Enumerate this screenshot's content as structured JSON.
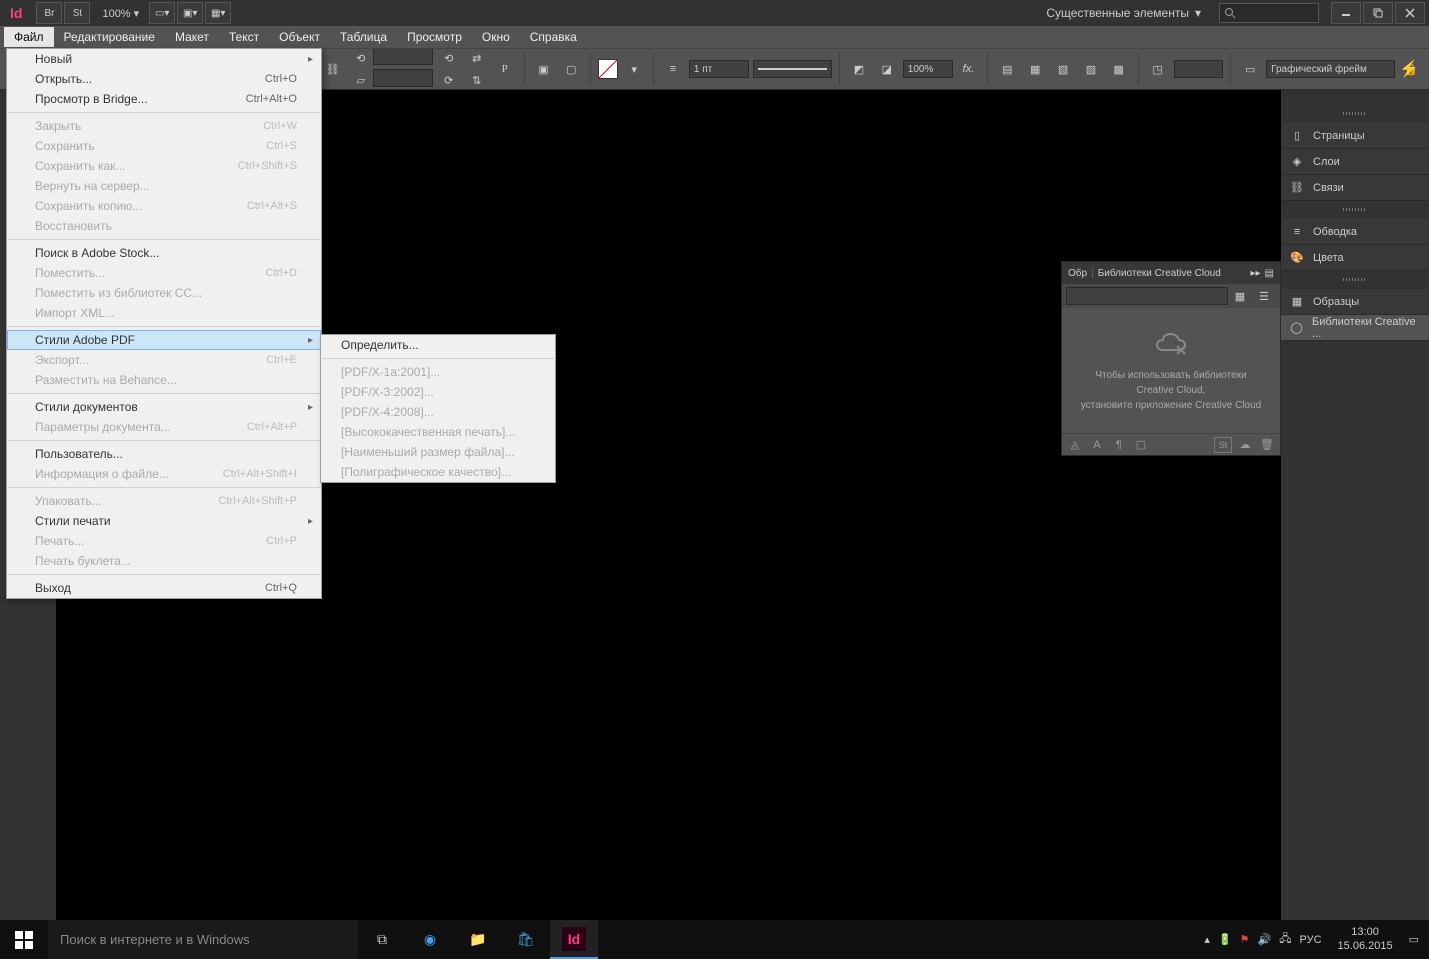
{
  "titlebar": {
    "zoom": "100%",
    "workspace_label": "Существенные элементы",
    "br_label": "Br",
    "st_label": "St"
  },
  "menubar": {
    "items": [
      "Файл",
      "Редактирование",
      "Макет",
      "Текст",
      "Объект",
      "Таблица",
      "Просмотр",
      "Окно",
      "Справка"
    ]
  },
  "ctrlstrip": {
    "stroke_pt": "1 пт",
    "scale_pct": "100%",
    "frame_type": "Графический фрейм"
  },
  "file_menu": {
    "items": [
      {
        "label": "Новый",
        "sub": true
      },
      {
        "label": "Открыть...",
        "shortcut": "Ctrl+O"
      },
      {
        "label": "Просмотр в Bridge...",
        "shortcut": "Ctrl+Alt+O"
      },
      {
        "sep": true
      },
      {
        "label": "Закрыть",
        "shortcut": "Ctrl+W",
        "disabled": true
      },
      {
        "label": "Сохранить",
        "shortcut": "Ctrl+S",
        "disabled": true
      },
      {
        "label": "Сохранить как...",
        "shortcut": "Ctrl+Shift+S",
        "disabled": true
      },
      {
        "label": "Вернуть на сервер...",
        "disabled": true
      },
      {
        "label": "Сохранить копию...",
        "shortcut": "Ctrl+Alt+S",
        "disabled": true
      },
      {
        "label": "Восстановить",
        "disabled": true
      },
      {
        "sep": true
      },
      {
        "label": "Поиск в Adobe Stock..."
      },
      {
        "label": "Поместить...",
        "shortcut": "Ctrl+D",
        "disabled": true
      },
      {
        "label": "Поместить из библиотек CC...",
        "disabled": true
      },
      {
        "label": "Импорт XML...",
        "disabled": true
      },
      {
        "sep": true
      },
      {
        "label": "Стили Adobe PDF",
        "sub": true,
        "hover": true
      },
      {
        "label": "Экспорт...",
        "shortcut": "Ctrl+E",
        "disabled": true
      },
      {
        "label": "Разместить на Behance...",
        "disabled": true
      },
      {
        "sep": true
      },
      {
        "label": "Стили документов",
        "sub": true
      },
      {
        "label": "Параметры документа...",
        "shortcut": "Ctrl+Alt+P",
        "disabled": true
      },
      {
        "sep": true
      },
      {
        "label": "Пользователь..."
      },
      {
        "label": "Информация о файле...",
        "shortcut": "Ctrl+Alt+Shift+I",
        "disabled": true
      },
      {
        "sep": true
      },
      {
        "label": "Упаковать...",
        "shortcut": "Ctrl+Alt+Shift+P",
        "disabled": true
      },
      {
        "label": "Стили печати",
        "sub": true
      },
      {
        "label": "Печать...",
        "shortcut": "Ctrl+P",
        "disabled": true
      },
      {
        "label": "Печать буклета...",
        "disabled": true
      },
      {
        "sep": true
      },
      {
        "label": "Выход",
        "shortcut": "Ctrl+Q"
      }
    ]
  },
  "pdf_submenu": {
    "items": [
      {
        "label": "Определить..."
      },
      {
        "sep": true
      },
      {
        "label": "[PDF/X-1a:2001]...",
        "disabled": true
      },
      {
        "label": "[PDF/X-3:2002]...",
        "disabled": true
      },
      {
        "label": "[PDF/X-4:2008]...",
        "disabled": true
      },
      {
        "label": "[Высококачественная печать]...",
        "disabled": true
      },
      {
        "label": "[Наименьший размер файла]...",
        "disabled": true
      },
      {
        "label": "[Полиграфическое качество]...",
        "disabled": true
      }
    ]
  },
  "panels": {
    "pages": "Страницы",
    "layers": "Слои",
    "links": "Связи",
    "stroke": "Обводка",
    "color": "Цвета",
    "swatches": "Образцы",
    "cc_libs": "Библиотеки Creative ..."
  },
  "cc_panel": {
    "tab_left": "Обр",
    "title": "Библиотеки Creative Cloud",
    "msg_line1": "Чтобы использовать библиотеки",
    "msg_line2": "Creative Cloud,",
    "msg_line3": "установите приложение Creative Cloud"
  },
  "taskbar": {
    "search_placeholder": "Поиск в интернете и в Windows",
    "lang": "РУС",
    "time": "13:00",
    "date": "15.06.2015"
  }
}
